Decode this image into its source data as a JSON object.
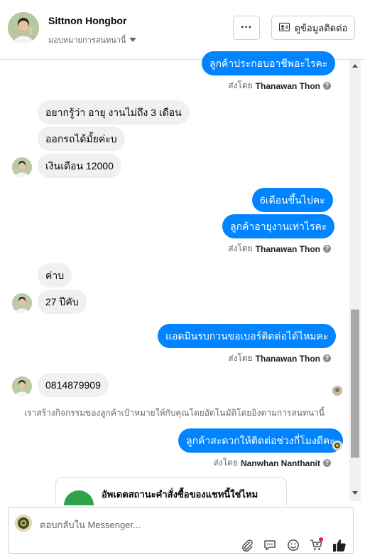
{
  "header": {
    "name": "Sittnon Hongbor",
    "assign_label": "มอบหมายการสนทนานี้",
    "more_label": "···",
    "contact_button": "ดูข้อมูลติดต่อ"
  },
  "messages": {
    "m1": "ลูกค้าประกอบอาชีพอะไรคะ",
    "m1_sent_prefix": "ส่งโดย",
    "m1_sender": "Thanawan Thon",
    "m2": "อยากรู้ว่า อายุ งานไม่ถึง 3 เดือน",
    "m3": "ออกรถได้มั้ยค่ะบ",
    "m4": "เงินเดือน 12000",
    "m5": "6เดือนขึ้นไปคะ",
    "m6": "ลูกค้าอายุงานเท่าไรคะ",
    "m6_sent_prefix": "ส่งโดย",
    "m6_sender": "Thanawan Thon",
    "m7": "ค่าบ",
    "m8": "27 ปีคับ",
    "m9": "แอดมินรบกวนขอเบอร์ติดต่อได้ไหมคะ",
    "m9_sent_prefix": "ส่งโดย",
    "m9_sender": "Thanawan Thon",
    "m10": "0814879909",
    "system_note": "เราสร้างกิจกรรมของลูกค้าเป้าหมายให้กับคุณโดยอัตโนมัติโดยอิงตามการสนทนานี้",
    "m11": "ลูกค้าสะดวกให้ติดต่อช่วงกี่โมงดีคะ",
    "m11_sent_prefix": "ส่งโดย",
    "m11_sender": "Nanwhan Nanthanit"
  },
  "card": {
    "title": "อัพเดตสถานะคำสั่งซื้อของแชทนี้ใช่ไหม"
  },
  "composer": {
    "placeholder": "ตอบกลับใน Messenger..."
  },
  "colors": {
    "outgoing_bubble": "#0084ff",
    "incoming_bubble": "#f0f0f0",
    "like_icon": "#1c1e21",
    "notification_dot": "#e41e3f",
    "card_status": "#31a24c"
  },
  "icons": [
    "ellipsis-icon",
    "contact-card-icon",
    "caret-down-icon",
    "help-icon",
    "attach-icon",
    "chat-icon",
    "emoji-icon",
    "cart-icon",
    "like-icon"
  ]
}
